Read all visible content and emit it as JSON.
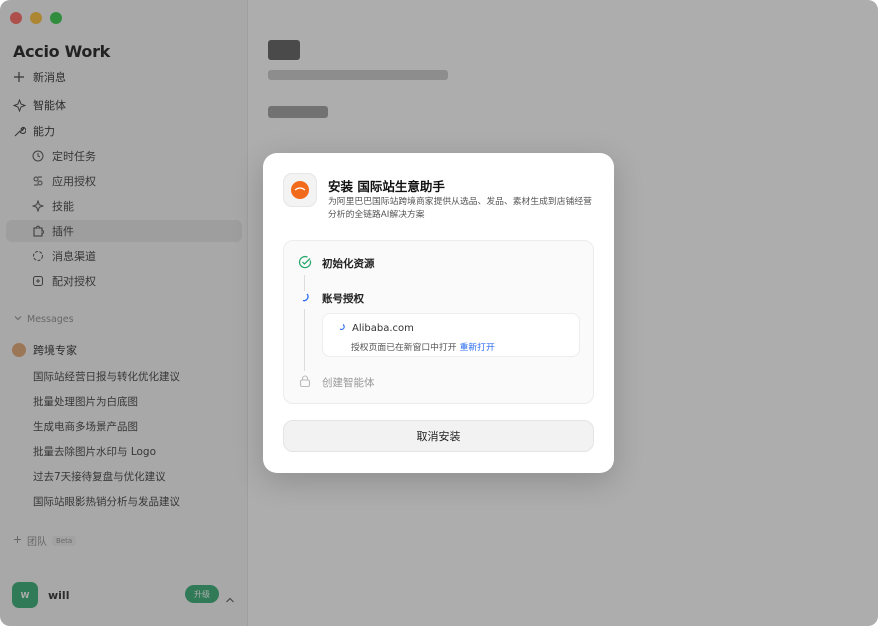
{
  "sidebar": {
    "brand": "Accio Work",
    "new_message": "新消息",
    "agents": "智能体",
    "capabilities": "能力",
    "sub_items": [
      {
        "label": "定时任务",
        "icon": "clock-icon"
      },
      {
        "label": "应用授权",
        "icon": "app-auth-icon"
      },
      {
        "label": "技能",
        "icon": "sparkle-icon"
      },
      {
        "label": "插件",
        "icon": "puzzle-icon"
      },
      {
        "label": "消息渠道",
        "icon": "channel-icon"
      },
      {
        "label": "配对授权",
        "icon": "pair-icon"
      }
    ],
    "messages_label": "Messages",
    "expert_name": "跨境专家",
    "chats": [
      "国际站经营日报与转化优化建议",
      "批量处理图片为白底图",
      "生成电商多场景产品图",
      "批量去除图片水印与 Logo",
      "过去7天接待复盘与优化建议",
      "国际站眼影热销分析与发品建议"
    ],
    "team_label": "团队",
    "beta_label": "Beta",
    "user_name": "will",
    "user_initial": "W",
    "upgrade_label": "升级"
  },
  "modal": {
    "title": "安装 国际站生意助手",
    "description": "为阿里巴巴国际站跨境商家提供从选品、发品、素材生成到店铺经营分析的全链路AI解决方案",
    "steps": {
      "init": "初始化资源",
      "auth": "账号授权",
      "create": "创建智能体"
    },
    "auth_card": {
      "site": "Alibaba.com",
      "status": "授权页面已在新窗口中打开",
      "reopen": "重新打开"
    },
    "cancel_label": "取消安装"
  },
  "colors": {
    "accent_green": "#2aa86c",
    "link_blue": "#2a6cf0",
    "alibaba_orange": "#f26a1b"
  }
}
